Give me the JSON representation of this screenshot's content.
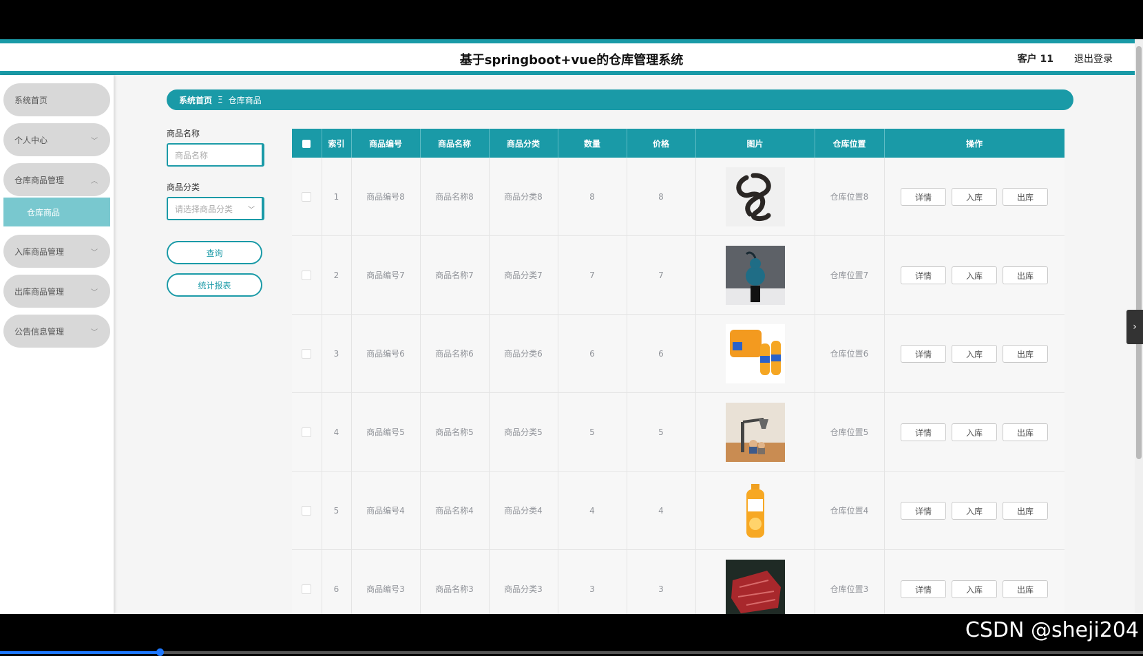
{
  "header": {
    "title": "基于springboot+vue的仓库管理系统",
    "user": "客户 11",
    "logout": "退出登录"
  },
  "sidebar": {
    "items": [
      {
        "label": "系统首页"
      },
      {
        "label": "个人中心"
      },
      {
        "label": "仓库商品管理"
      },
      {
        "label": "仓库商品"
      },
      {
        "label": "入库商品管理"
      },
      {
        "label": "出库商品管理"
      },
      {
        "label": "公告信息管理"
      }
    ]
  },
  "breadcrumb": {
    "home": "系统首页",
    "separator": "Ξ",
    "current": "仓库商品"
  },
  "search": {
    "name_label": "商品名称",
    "name_placeholder": "商品名称",
    "category_label": "商品分类",
    "category_placeholder": "请选择商品分类",
    "query_button": "查询",
    "report_button": "统计报表"
  },
  "table": {
    "columns": [
      "索引",
      "商品编号",
      "商品名称",
      "商品分类",
      "数量",
      "价格",
      "图片",
      "仓库位置",
      "操作"
    ],
    "actions": {
      "detail": "详情",
      "in": "入库",
      "out": "出库"
    },
    "rows": [
      {
        "index": "1",
        "code": "商品编号8",
        "name": "商品名称8",
        "category": "商品分类8",
        "qty": "8",
        "price": "8",
        "image": "dark-knot-ornament",
        "location": "仓库位置8"
      },
      {
        "index": "2",
        "code": "商品编号7",
        "name": "商品名称7",
        "category": "商品分类7",
        "qty": "7",
        "price": "7",
        "image": "blue-gourd-figure",
        "location": "仓库位置7"
      },
      {
        "index": "3",
        "code": "商品编号6",
        "name": "商品名称6",
        "category": "商品分类6",
        "qty": "6",
        "price": "6",
        "image": "orange-juice-bottles",
        "location": "仓库位置6"
      },
      {
        "index": "4",
        "code": "商品编号5",
        "name": "商品名称5",
        "category": "商品分类5",
        "qty": "5",
        "price": "5",
        "image": "figurine-lamp",
        "location": "仓库位置5"
      },
      {
        "index": "5",
        "code": "商品编号4",
        "name": "商品名称4",
        "category": "商品分类4",
        "qty": "4",
        "price": "4",
        "image": "orange-juice-bottle",
        "location": "仓库位置4"
      },
      {
        "index": "6",
        "code": "商品编号3",
        "name": "商品名称3",
        "category": "商品分类3",
        "qty": "3",
        "price": "3",
        "image": "raw-beef",
        "location": "仓库位置3"
      }
    ]
  },
  "watermark": "CSDN @sheji204",
  "colors": {
    "accent": "#1a9aa7",
    "submenu_active": "#79c8cf"
  }
}
